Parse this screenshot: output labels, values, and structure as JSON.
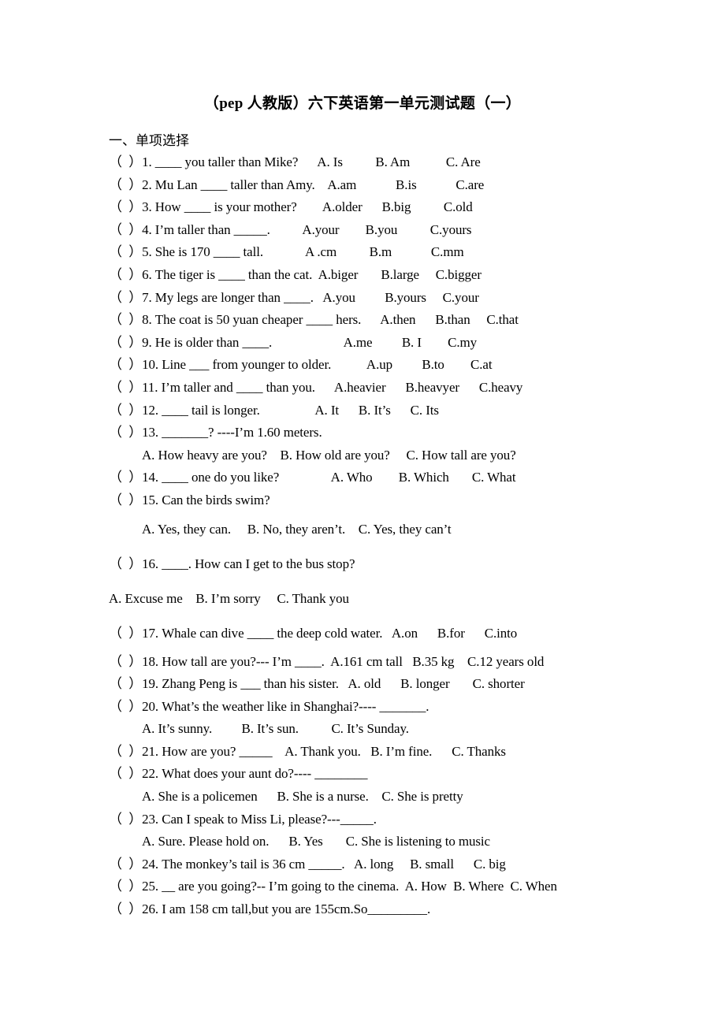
{
  "document": {
    "title": "（pep 人教版）六下英语第一单元测试题（一）",
    "section_heading": "一、单项选择"
  },
  "questions": [
    {
      "id": "q1",
      "text": "（  ）1. ____ you taller than Mike?      A. Is          B. Am           C. Are",
      "style": "normal"
    },
    {
      "id": "q2",
      "text": "（  ）2. Mu Lan ____ taller than Amy.    A.am            B.is            C.are",
      "style": "normal"
    },
    {
      "id": "q3",
      "text": "（  ）3. How ____ is your mother?        A.older      B.big          C.old",
      "style": "normal"
    },
    {
      "id": "q4",
      "text": "（  ）4. I’m taller than _____.          A.your        B.you          C.yours",
      "style": "normal"
    },
    {
      "id": "q5",
      "text": "（  ）5. She is 170 ____ tall.             A .cm          B.m            C.mm",
      "style": "normal"
    },
    {
      "id": "q6",
      "text": "（  ）6. The tiger is ____ than the cat.  A.biger       B.large     C.bigger",
      "style": "normal"
    },
    {
      "id": "q7",
      "text": "（  ）7. My legs are longer than ____.   A.you         B.yours     C.your",
      "style": "normal"
    },
    {
      "id": "q8",
      "text": "（  ）8. The coat is 50 yuan cheaper ____ hers.      A.then      B.than     C.that",
      "style": "normal"
    },
    {
      "id": "q9",
      "text": "（  ）9. He is older than ____.                      A.me         B. I        C.my",
      "style": "normal"
    },
    {
      "id": "q10",
      "text": "（  ）10. Line ___ from younger to older.           A.up         B.to        C.at",
      "style": "normal"
    },
    {
      "id": "q11",
      "text": "（  ）11. I’m taller and ____ than you.      A.heavier      B.heavyer      C.heavy",
      "style": "normal"
    },
    {
      "id": "q12",
      "text": "（  ）12. ____ tail is longer.                 A. It      B. It’s      C. Its",
      "style": "normal"
    },
    {
      "id": "q13",
      "text": "（  ）13. _______? ----I’m 1.60 meters.",
      "style": "normal"
    },
    {
      "id": "q13-options",
      "text": "A. How heavy are you?    B. How old are you?     C. How tall are you?",
      "style": "indent"
    },
    {
      "id": "q14",
      "text": "（  ）14. ____ one do you like?                A. Who        B. Which       C. What",
      "style": "normal"
    },
    {
      "id": "q15",
      "text": "（  ）15. Can the birds swim?",
      "style": "normal"
    },
    {
      "id": "q15-options",
      "text": "A. Yes, they can.     B. No, they aren’t.    C. Yes, they can’t",
      "style": "indent-wide"
    },
    {
      "id": "q16",
      "text": "（  ）16. ____. How can I get to the bus stop?",
      "style": "wide"
    },
    {
      "id": "q16-options",
      "text": "A. Excuse me    B. I’m sorry     C. Thank you",
      "style": "flush-wide"
    },
    {
      "id": "q17",
      "text": "（  ）17. Whale can dive ____ the deep cold water.   A.on      B.for      C.into",
      "style": "wide"
    },
    {
      "id": "q18",
      "text": "（  ）18. How tall are you?--- I’m ____.  A.161 cm tall   B.35 kg    C.12 years old",
      "style": "normal"
    },
    {
      "id": "q19",
      "text": "（  ）19. Zhang Peng is ___ than his sister.   A. old      B. longer       C. shorter",
      "style": "normal"
    },
    {
      "id": "q20",
      "text": "（  ）20. What’s the weather like in Shanghai?---- _______.",
      "style": "normal"
    },
    {
      "id": "q20-options",
      "text": "A. It’s sunny.         B. It’s sun.          C. It’s Sunday.",
      "style": "indent"
    },
    {
      "id": "q21",
      "text": "（  ）21. How are you? _____    A. Thank you.   B. I’m fine.      C. Thanks",
      "style": "normal"
    },
    {
      "id": "q22",
      "text": "（  ）22. What does your aunt do?---- ________",
      "style": "normal"
    },
    {
      "id": "q22-options",
      "text": "A. She is a policemen      B. She is a nurse.    C. She is pretty",
      "style": "indent"
    },
    {
      "id": "q23",
      "text": "（  ）23. Can I speak to Miss Li, please?---_____.",
      "style": "normal"
    },
    {
      "id": "q23-options",
      "text": "A. Sure. Please hold on.      B. Yes       C. She is listening to music",
      "style": "indent"
    },
    {
      "id": "q24",
      "text": "（  ）24. The monkey’s tail is 36 cm _____.   A. long     B. small      C. big",
      "style": "normal"
    },
    {
      "id": "q25",
      "text": "（  ）25. __ are you going?-- I’m going to the cinema.  A. How  B. Where  C. When",
      "style": "normal"
    },
    {
      "id": "q26",
      "text": "（  ）26. I am 158 cm tall,but you are 155cm.So_________.",
      "style": "normal"
    }
  ],
  "colors": {
    "page_background": "#ffffff",
    "text": "#000000"
  }
}
